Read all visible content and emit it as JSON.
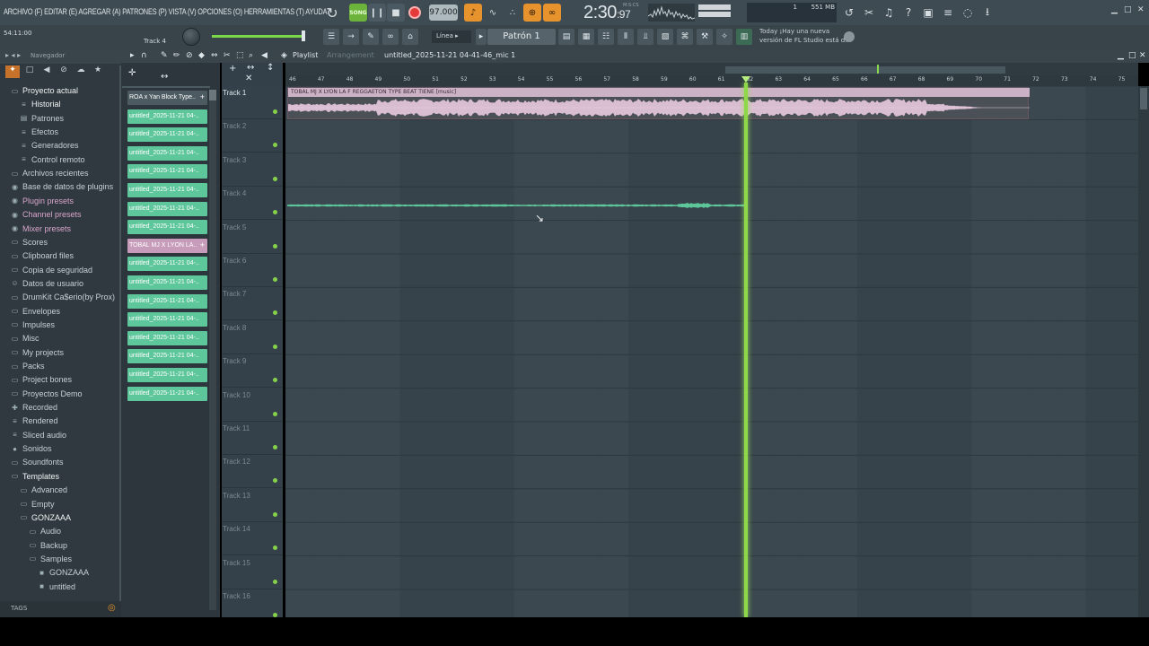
{
  "menu_text": "ARCHIVO (F) EDITAR (E) AGREGAR (A) PATRONES (P) VISTA (V) OPCIONES (O) HERRAMIENTAS (T) AYUDA",
  "transport": {
    "mode": "SONG",
    "tempo": "97.000",
    "time_main": "2:30",
    "time_sub": "97",
    "time_unit": "M:S:CS"
  },
  "resources": {
    "cpu": "1",
    "memory": "551 MB"
  },
  "hint": {
    "time": "54:11:00",
    "track": "Track 4"
  },
  "snap": "Línea",
  "pattern": "Patrón 1",
  "news": {
    "line1": "Today  ¡Hay una nueva",
    "line2": "versión de FL Studio está d.."
  },
  "browser": {
    "title": "Navegador",
    "items": [
      {
        "label": "Proyecto actual",
        "icon": "folder-icon",
        "indent": 0,
        "style": "hl"
      },
      {
        "label": "Historial",
        "icon": "history-icon",
        "indent": 1,
        "style": "hl"
      },
      {
        "label": "Patrones",
        "icon": "pattern-icon",
        "indent": 1,
        "style": ""
      },
      {
        "label": "Efectos",
        "icon": "effects-icon",
        "indent": 1,
        "style": ""
      },
      {
        "label": "Generadores",
        "icon": "generator-icon",
        "indent": 1,
        "style": ""
      },
      {
        "label": "Control remoto",
        "icon": "remote-icon",
        "indent": 1,
        "style": ""
      },
      {
        "label": "Archivos recientes",
        "icon": "recent-icon",
        "indent": 0,
        "style": ""
      },
      {
        "label": "Base de datos de plugins",
        "icon": "plugin-db-icon",
        "indent": 0,
        "style": ""
      },
      {
        "label": "Plugin presets",
        "icon": "plugin-presets-icon",
        "indent": 0,
        "style": "pink"
      },
      {
        "label": "Channel presets",
        "icon": "channel-presets-icon",
        "indent": 0,
        "style": "pink"
      },
      {
        "label": "Mixer presets",
        "icon": "mixer-presets-icon",
        "indent": 0,
        "style": "pink"
      },
      {
        "label": "Scores",
        "icon": "folder-icon",
        "indent": 0,
        "style": ""
      },
      {
        "label": "Clipboard files",
        "icon": "folder-icon",
        "indent": 0,
        "style": ""
      },
      {
        "label": "Copia de seguridad",
        "icon": "backup-icon",
        "indent": 0,
        "style": ""
      },
      {
        "label": "Datos de usuario",
        "icon": "user-icon",
        "indent": 0,
        "style": ""
      },
      {
        "label": "DrumKit Ca$erio(by Prox)",
        "icon": "folder-icon",
        "indent": 0,
        "style": ""
      },
      {
        "label": "Envelopes",
        "icon": "folder-icon",
        "indent": 0,
        "style": ""
      },
      {
        "label": "Impulses",
        "icon": "folder-icon",
        "indent": 0,
        "style": ""
      },
      {
        "label": "Misc",
        "icon": "folder-icon",
        "indent": 0,
        "style": ""
      },
      {
        "label": "My projects",
        "icon": "folder-icon",
        "indent": 0,
        "style": ""
      },
      {
        "label": "Packs",
        "icon": "folder-icon",
        "indent": 0,
        "style": ""
      },
      {
        "label": "Project bones",
        "icon": "folder-icon",
        "indent": 0,
        "style": ""
      },
      {
        "label": "Proyectos Demo",
        "icon": "folder-icon",
        "indent": 0,
        "style": ""
      },
      {
        "label": "Recorded",
        "icon": "recorded-icon",
        "indent": 0,
        "style": ""
      },
      {
        "label": "Rendered",
        "icon": "rendered-icon",
        "indent": 0,
        "style": ""
      },
      {
        "label": "Sliced audio",
        "icon": "sliced-icon",
        "indent": 0,
        "style": ""
      },
      {
        "label": "Sonidos",
        "icon": "sounds-icon",
        "indent": 0,
        "style": ""
      },
      {
        "label": "Soundfonts",
        "icon": "folder-icon",
        "indent": 0,
        "style": ""
      },
      {
        "label": "Templates",
        "icon": "folder-open-icon",
        "indent": 0,
        "style": "hl"
      },
      {
        "label": "Advanced",
        "icon": "folder-icon",
        "indent": 1,
        "style": ""
      },
      {
        "label": "Empty",
        "icon": "folder-icon",
        "indent": 1,
        "style": ""
      },
      {
        "label": "GONZAAA",
        "icon": "folder-open-icon",
        "indent": 1,
        "style": "hl"
      },
      {
        "label": "Audio",
        "icon": "folder-icon",
        "indent": 2,
        "style": ""
      },
      {
        "label": "Backup",
        "icon": "folder-icon",
        "indent": 2,
        "style": ""
      },
      {
        "label": "Samples",
        "icon": "folder-icon",
        "indent": 2,
        "style": ""
      },
      {
        "label": "GONZAAA",
        "icon": "file-icon",
        "indent": 3,
        "style": ""
      },
      {
        "label": "untitled",
        "icon": "file-icon",
        "indent": 3,
        "style": ""
      }
    ],
    "tags_label": "TAGS"
  },
  "playlist": {
    "title": "Playlist",
    "subtitle": "Arrangement",
    "name": "untitled_2025-11-21 04-41-46_mic 1",
    "clips": [
      {
        "label": "ROA x Yan Block Type..",
        "style": "dark"
      },
      {
        "label": "untitled_2025-11-21 04-..",
        "style": ""
      },
      {
        "label": "untitled_2025-11-21 04-..",
        "style": ""
      },
      {
        "label": "untitled_2025-11-21 04-..",
        "style": ""
      },
      {
        "label": "untitled_2025-11-21 04-..",
        "style": ""
      },
      {
        "label": "untitled_2025-11-21 04-..",
        "style": ""
      },
      {
        "label": "untitled_2025-11-21 04-..",
        "style": ""
      },
      {
        "label": "untitled_2025-11-21 04-..",
        "style": ""
      },
      {
        "label": "TOBAL MJ X LYON LA..",
        "style": "pink"
      },
      {
        "label": "untitled_2025-11-21 04-..",
        "style": ""
      },
      {
        "label": "untitled_2025-11-21 04-..",
        "style": ""
      },
      {
        "label": "untitled_2025-11-21 04-..",
        "style": ""
      },
      {
        "label": "untitled_2025-11-21 04-..",
        "style": ""
      },
      {
        "label": "untitled_2025-11-21 04-..",
        "style": ""
      },
      {
        "label": "untitled_2025-11-21 04-..",
        "style": ""
      },
      {
        "label": "untitled_2025-11-21 04-..",
        "style": ""
      },
      {
        "label": "untitled_2025-11-21 04-..",
        "style": ""
      }
    ],
    "tracks": [
      "Track 1",
      "Track 2",
      "Track 3",
      "Track 4",
      "Track 5",
      "Track 6",
      "Track 7",
      "Track 8",
      "Track 9",
      "Track 10",
      "Track 11",
      "Track 12",
      "Track 13",
      "Track 14",
      "Track 15",
      "Track 16"
    ],
    "ruler": [
      "46",
      "47",
      "48",
      "49",
      "50",
      "51",
      "52",
      "53",
      "54",
      "55",
      "56",
      "57",
      "58",
      "59",
      "60",
      "61",
      "62",
      "63",
      "64",
      "65",
      "66",
      "67",
      "68",
      "69",
      "70",
      "71",
      "72",
      "73",
      "74",
      "75"
    ],
    "audio_clip_label": "TOBAL MJ X LYON LA F REGGAETON TYPE BEAT TIENE [music]",
    "colors": {
      "clip_green": "#5ec69b",
      "clip_pink": "#ccb2c5",
      "playhead": "#8ed84a"
    }
  }
}
